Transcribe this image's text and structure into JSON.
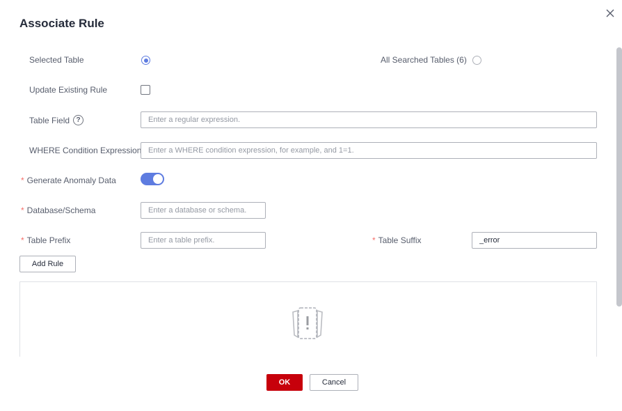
{
  "dialog": {
    "title": "Associate Rule",
    "close_icon": "close-icon"
  },
  "form": {
    "selected_table_label": "Selected Table",
    "all_searched_tables_label": "All Searched Tables (6)",
    "update_existing_rule_label": "Update Existing Rule",
    "table_field_label": "Table Field",
    "table_field_help_glyph": "?",
    "table_field_placeholder": "Enter a regular expression.",
    "where_label": "WHERE Condition Expression",
    "where_placeholder": "Enter a WHERE condition expression, for example, and 1=1.",
    "anomaly_label": "Generate Anomaly Data",
    "database_label": "Database/Schema",
    "database_placeholder": "Enter a database or schema.",
    "prefix_label": "Table Prefix",
    "prefix_placeholder": "Enter a table prefix.",
    "suffix_label": "Table Suffix",
    "suffix_value": "_error",
    "required_mark": "*"
  },
  "state": {
    "selected_table_checked": true,
    "all_searched_checked": false,
    "update_existing_checked": false,
    "anomaly_enabled": true
  },
  "add_rule_label": "Add Rule",
  "footer": {
    "ok_label": "OK",
    "cancel_label": "Cancel"
  },
  "colors": {
    "primary": "#c7000b",
    "accent": "#5e7ce0",
    "required": "#f66f6a"
  }
}
